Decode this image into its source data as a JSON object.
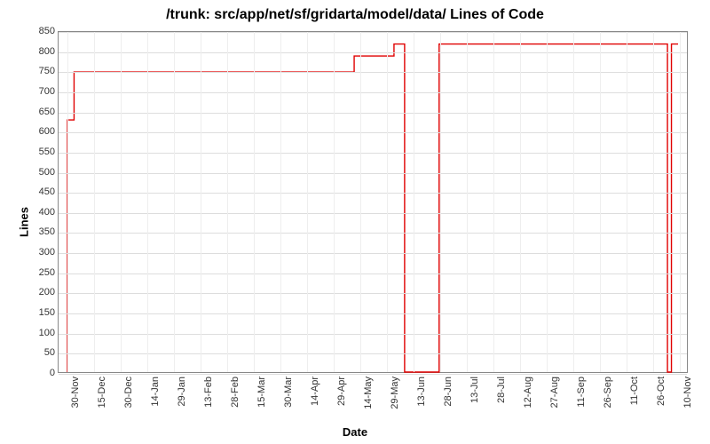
{
  "title": "/trunk: src/app/net/sf/gridarta/model/data/ Lines of Code",
  "xlabel": "Date",
  "ylabel": "Lines",
  "y_ticks": [
    0,
    50,
    100,
    150,
    200,
    250,
    300,
    350,
    400,
    450,
    500,
    550,
    600,
    650,
    700,
    750,
    800,
    850
  ],
  "x_ticks": [
    "30-Nov",
    "15-Dec",
    "30-Dec",
    "14-Jan",
    "29-Jan",
    "13-Feb",
    "28-Feb",
    "15-Mar",
    "30-Mar",
    "14-Apr",
    "29-Apr",
    "14-May",
    "29-May",
    "13-Jun",
    "28-Jun",
    "13-Jul",
    "28-Jul",
    "12-Aug",
    "27-Aug",
    "11-Sep",
    "26-Sep",
    "11-Oct",
    "26-Oct",
    "10-Nov"
  ],
  "chart_data": {
    "type": "line",
    "title": "/trunk: src/app/net/sf/gridarta/model/data/ Lines of Code",
    "xlabel": "Date",
    "ylabel": "Lines",
    "ylim": [
      0,
      850
    ],
    "x": [
      "30-Nov",
      "15-Dec",
      "30-Dec",
      "14-Jan",
      "29-Jan",
      "13-Feb",
      "28-Feb",
      "15-Mar",
      "30-Mar",
      "14-Apr",
      "29-Apr",
      "14-May",
      "29-May",
      "13-Jun",
      "28-Jun",
      "13-Jul",
      "28-Jul",
      "12-Aug",
      "27-Aug",
      "11-Sep",
      "26-Sep",
      "11-Oct",
      "26-Oct",
      "10-Nov"
    ],
    "series": [
      {
        "name": "Lines of Code",
        "color": "#e00000",
        "points": [
          {
            "x_index": 0.0,
            "y": 0
          },
          {
            "x_index": 0.0,
            "y": 630
          },
          {
            "x_index": 0.25,
            "y": 630
          },
          {
            "x_index": 0.25,
            "y": 750
          },
          {
            "x_index": 10.8,
            "y": 750
          },
          {
            "x_index": 10.8,
            "y": 790
          },
          {
            "x_index": 12.3,
            "y": 790
          },
          {
            "x_index": 12.3,
            "y": 820
          },
          {
            "x_index": 12.7,
            "y": 820
          },
          {
            "x_index": 12.7,
            "y": 0
          },
          {
            "x_index": 14.0,
            "y": 0
          },
          {
            "x_index": 14.0,
            "y": 820
          },
          {
            "x_index": 22.6,
            "y": 820
          },
          {
            "x_index": 22.6,
            "y": 0
          },
          {
            "x_index": 22.75,
            "y": 0
          },
          {
            "x_index": 22.75,
            "y": 820
          },
          {
            "x_index": 23.0,
            "y": 820
          }
        ]
      }
    ]
  }
}
